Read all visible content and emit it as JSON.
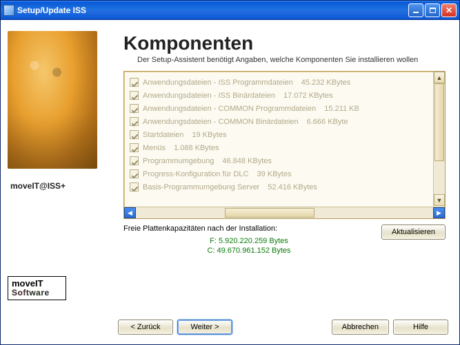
{
  "window": {
    "title": "Setup/Update ISS"
  },
  "sidebar": {
    "brand": "moveIT@ISS+",
    "logo_line1": "moveIT",
    "logo_line2": "Software"
  },
  "page": {
    "heading": "Komponenten",
    "subheading": "Der Setup-Assistent benötigt Angaben, welche Komponenten Sie installieren wollen"
  },
  "components": [
    {
      "label": "Anwendungsdateien - ISS Programmdateien",
      "size": "45.232 KBytes"
    },
    {
      "label": "Anwendungsdateien - ISS Binärdateien",
      "size": "17.072 KBytes"
    },
    {
      "label": "Anwendungsdateien - COMMON Programmdateien",
      "size": "15.211 KB"
    },
    {
      "label": "Anwendungsdateien - COMMON Binärdateien",
      "size": "6.666 KByte"
    },
    {
      "label": "Startdateien",
      "size": "19 KBytes"
    },
    {
      "label": "Menüs",
      "size": "1.088 KBytes"
    },
    {
      "label": "Programmumgebung",
      "size": "46.848 KBytes"
    },
    {
      "label": "Progress-Konfiguration für DLC",
      "size": "39 KBytes"
    },
    {
      "label": "Basis-Programmumgebung Server",
      "size": "52.416 KBytes"
    }
  ],
  "free_space": {
    "label": "Freie Plattenkapazitäten nach der Installation:",
    "rows": [
      "F: 5.920.220.259 Bytes",
      "C: 49.670.961.152 Bytes"
    ]
  },
  "buttons": {
    "refresh": "Aktualisieren",
    "back": "< Zurück",
    "next": "Weiter >",
    "cancel": "Abbrechen",
    "help": "Hilfe"
  }
}
